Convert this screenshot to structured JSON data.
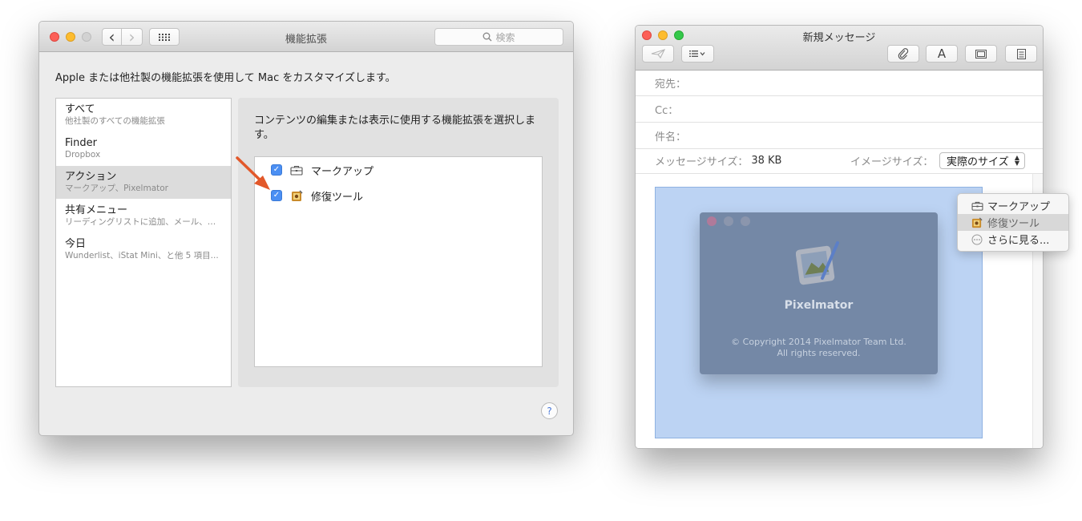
{
  "prefs_window": {
    "title": "機能拡張",
    "search_placeholder": "検索",
    "back_glyph": "‹",
    "forward_glyph": "›",
    "description": "Apple または他社製の機能拡張を使用して Mac をカスタマイズします。",
    "sidebar": [
      {
        "name": "すべて",
        "sub": "他社製のすべての機能拡張"
      },
      {
        "name": "Finder",
        "sub": "Dropbox"
      },
      {
        "name": "アクション",
        "sub": "マークアップ、Pixelmator",
        "selected": true
      },
      {
        "name": "共有メニュー",
        "sub": "リーディングリストに追加、メール、…"
      },
      {
        "name": "今日",
        "sub": "Wunderlist、iStat Mini、と他 5 項目..."
      }
    ],
    "panel_description": "コンテンツの編集または表示に使用する機能拡張を選択します。",
    "extensions": [
      {
        "label": "マークアップ",
        "checked": true,
        "icon": "toolbox-icon"
      },
      {
        "label": "修復ツール",
        "checked": true,
        "icon": "pixelmator-repair-icon"
      }
    ],
    "help_glyph": "?",
    "annotation_color": "#e2582a"
  },
  "mail_window": {
    "title": "新規メッセージ",
    "fields": {
      "to_label": "宛先：",
      "cc_label": "Cc：",
      "subject_label": "件名："
    },
    "message_size_label": "メッセージサイズ：",
    "message_size_value": "38 KB",
    "image_size_label": "イメージサイズ：",
    "image_size_value": "実際のサイズ",
    "toolbar_text_button": "A",
    "about_panel": {
      "app_name": "Pixelmator",
      "copyright_line1": "© Copyright 2014 Pixelmator Team Ltd.",
      "copyright_line2": "All rights reserved."
    },
    "context_menu": [
      {
        "label": "マークアップ",
        "icon": "toolbox-icon"
      },
      {
        "label": "修復ツール",
        "icon": "pixelmator-repair-icon",
        "highlighted": true
      },
      {
        "label": "さらに見る...",
        "icon": "more-icon"
      }
    ]
  }
}
